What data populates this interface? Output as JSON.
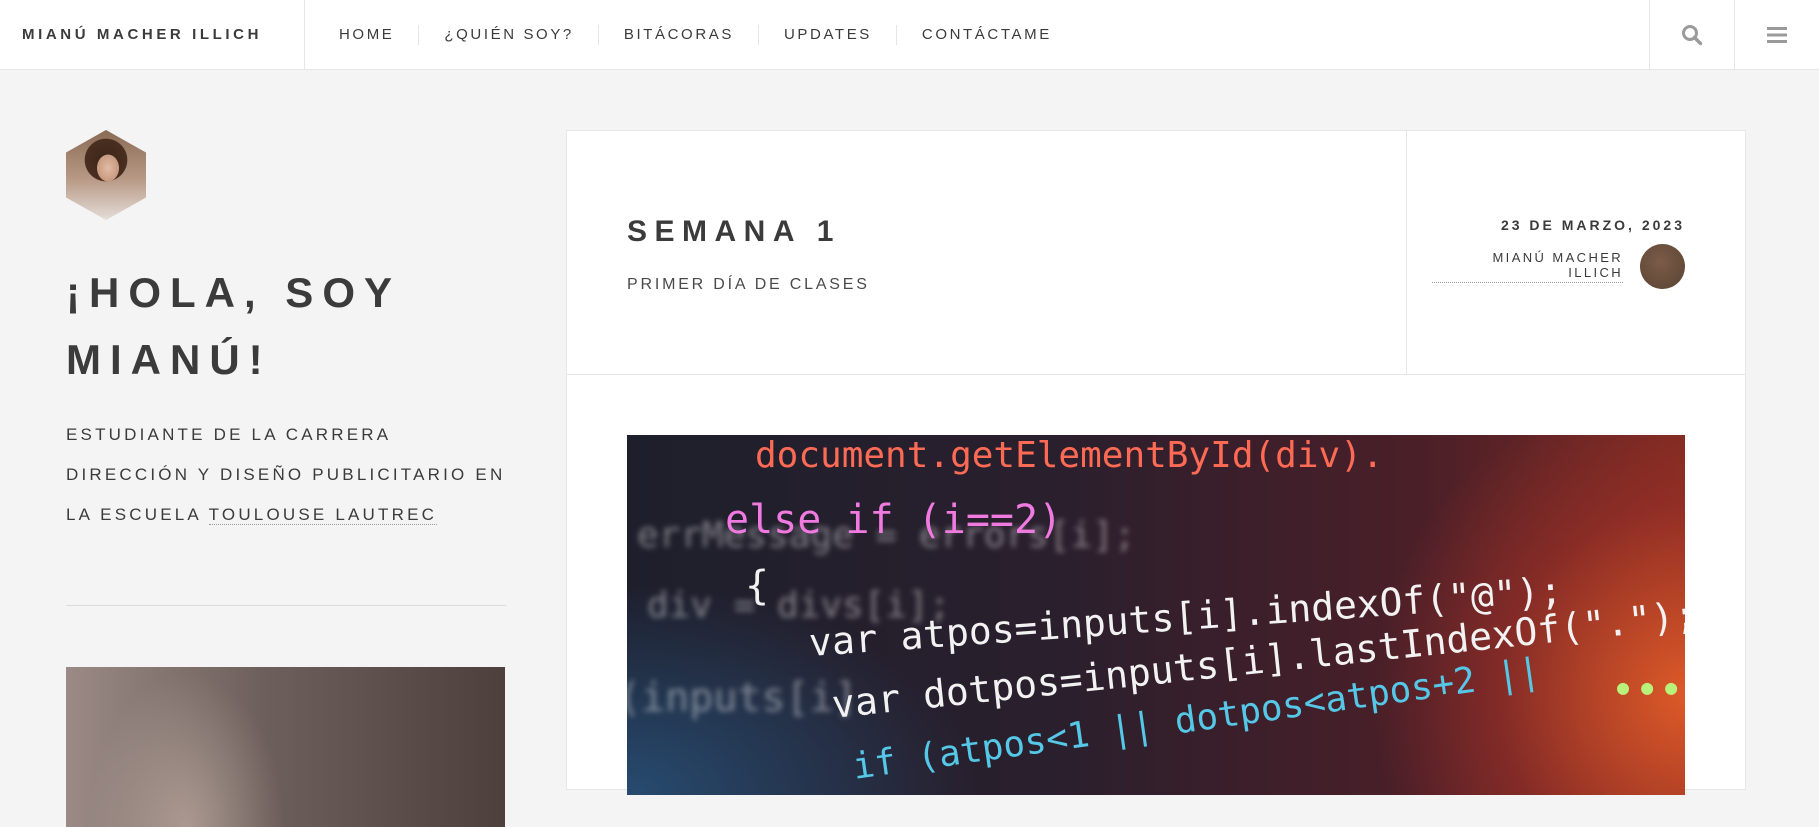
{
  "header": {
    "brand": "MIANÚ MACHER ILLICH",
    "nav": [
      {
        "label": "HOME"
      },
      {
        "label": "¿QUIÉN SOY?"
      },
      {
        "label": "BITÁCORAS"
      },
      {
        "label": "UPDATES"
      },
      {
        "label": "CONTÁCTAME"
      }
    ],
    "search_icon": "search-icon",
    "menu_icon": "hamburger-menu-icon"
  },
  "sidebar": {
    "greeting_line1": "¡HOLA, SOY",
    "greeting_line2": "MIANÚ!",
    "intro_line1": "ESTUDIANTE DE LA CARRERA",
    "intro_line2": "DIRECCIÓN Y DISEÑO PUBLICITARIO EN",
    "intro_line3_prefix": "LA ESCUELA ",
    "intro_link": "TOULOUSE LAUTREC"
  },
  "post": {
    "title": "SEMANA 1",
    "subtitle": "PRIMER DÍA DE CLASES",
    "date": "23 DE MARZO, 2023",
    "author": "MIANÚ MACHER ILLICH",
    "code_lines": [
      "document.getElementById(div).",
      "else if (i==2)",
      "{",
      "var atpos=inputs[i].indexOf(\"@\");",
      "var dotpos=inputs[i].lastIndexOf(\".\");",
      "if (atpos<1 || dotpos<atpos+2 ||"
    ]
  },
  "colors": {
    "text": "#3c3b3b",
    "background": "#f4f4f4",
    "card": "#ffffff",
    "border": "#e6e6e6"
  }
}
